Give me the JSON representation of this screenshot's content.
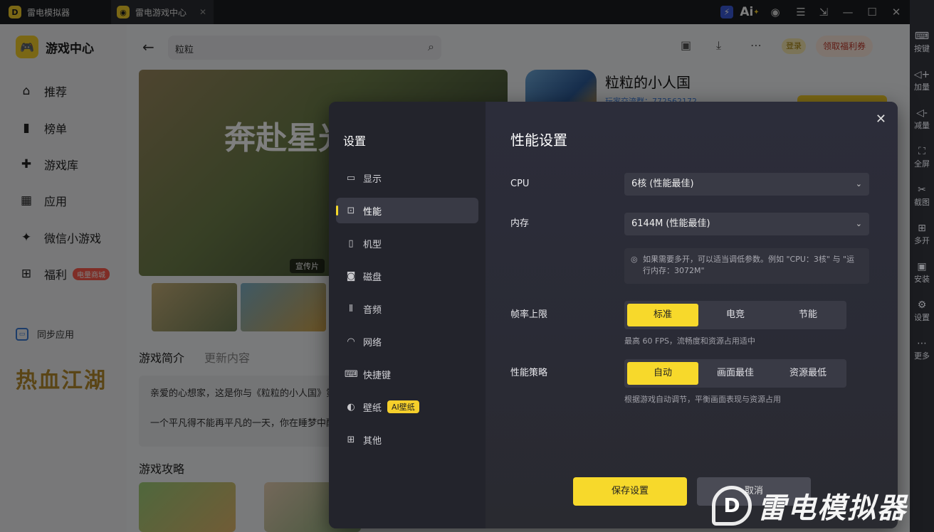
{
  "titlebar": {
    "tabs": [
      {
        "label": "雷电模拟器"
      },
      {
        "label": "雷电游戏中心"
      }
    ],
    "ai_label": "Ai"
  },
  "right_toolbar": [
    {
      "label": "按键",
      "icon": "keyboard-icon"
    },
    {
      "label": "加量",
      "icon": "volume-up-icon"
    },
    {
      "label": "减量",
      "icon": "volume-down-icon"
    },
    {
      "label": "全屏",
      "icon": "fullscreen-icon"
    },
    {
      "label": "截图",
      "icon": "scissors-icon"
    },
    {
      "label": "多开",
      "icon": "multi-instance-icon"
    },
    {
      "label": "安装",
      "icon": "install-icon"
    },
    {
      "label": "设置",
      "icon": "gear-icon"
    },
    {
      "label": "更多",
      "icon": "more-icon"
    }
  ],
  "app": {
    "brand": "游戏中心",
    "nav": [
      {
        "label": "推荐",
        "icon": "home-icon"
      },
      {
        "label": "榜单",
        "icon": "chart-icon"
      },
      {
        "label": "游戏库",
        "icon": "gamepad-icon"
      },
      {
        "label": "应用",
        "icon": "apps-icon"
      },
      {
        "label": "微信小游戏",
        "icon": "mini-game-icon"
      },
      {
        "label": "福利",
        "icon": "gift-icon",
        "badge": "电量商城"
      }
    ],
    "sync_label": "同步应用",
    "search_value": "粒粒",
    "login_label": "登录",
    "welfare_label": "领取福利券",
    "hero_title": "奔赴星光",
    "hero_badge": "宣传片",
    "game_title": "粒粒的小人国",
    "game_sub": "玩家交流群：772562172",
    "tabs": [
      "游戏简介",
      "更新内容"
    ],
    "intro_lines": [
      "亲爱的心想家，这是你与《粒粒的小人国》第",
      "一个平凡得不能再平凡的一天，你在睡梦中醒"
    ],
    "guide_title": "游戏攻略"
  },
  "dialog": {
    "sidebar_title": "设置",
    "menu": [
      {
        "label": "显示",
        "icon": "monitor-icon"
      },
      {
        "label": "性能",
        "icon": "performance-icon"
      },
      {
        "label": "机型",
        "icon": "phone-icon"
      },
      {
        "label": "磁盘",
        "icon": "disk-icon"
      },
      {
        "label": "音频",
        "icon": "audio-icon"
      },
      {
        "label": "网络",
        "icon": "wifi-icon"
      },
      {
        "label": "快捷键",
        "icon": "keyboard-icon"
      },
      {
        "label": "壁纸",
        "icon": "palette-icon",
        "badge": "AI壁纸"
      },
      {
        "label": "其他",
        "icon": "grid-icon"
      }
    ],
    "active_menu": "性能",
    "panel_title": "性能设置",
    "cpu": {
      "label": "CPU",
      "value": "6核 (性能最佳)"
    },
    "memory": {
      "label": "内存",
      "value": "6144M (性能最佳)"
    },
    "tip": "如果需要多开，可以适当调低参数。例如 \"CPU：3核\" 与 \"运行内存：3072M\"",
    "fps": {
      "label": "帧率上限",
      "options": [
        "标准",
        "电竞",
        "节能"
      ],
      "selected": "标准",
      "hint": "最高 60 FPS，流畅度和资源占用适中"
    },
    "strategy": {
      "label": "性能策略",
      "options": [
        "自动",
        "画面最佳",
        "资源最低"
      ],
      "selected": "自动",
      "hint": "根据游戏自动调节，平衡画面表现与资源占用"
    },
    "save_label": "保存设置",
    "cancel_label": "取消"
  },
  "watermark": "雷电模拟器",
  "colors": {
    "accent": "#f7d92b",
    "dialog_bg": "#2a2b35",
    "dialog_sidebar": "#23242c"
  }
}
